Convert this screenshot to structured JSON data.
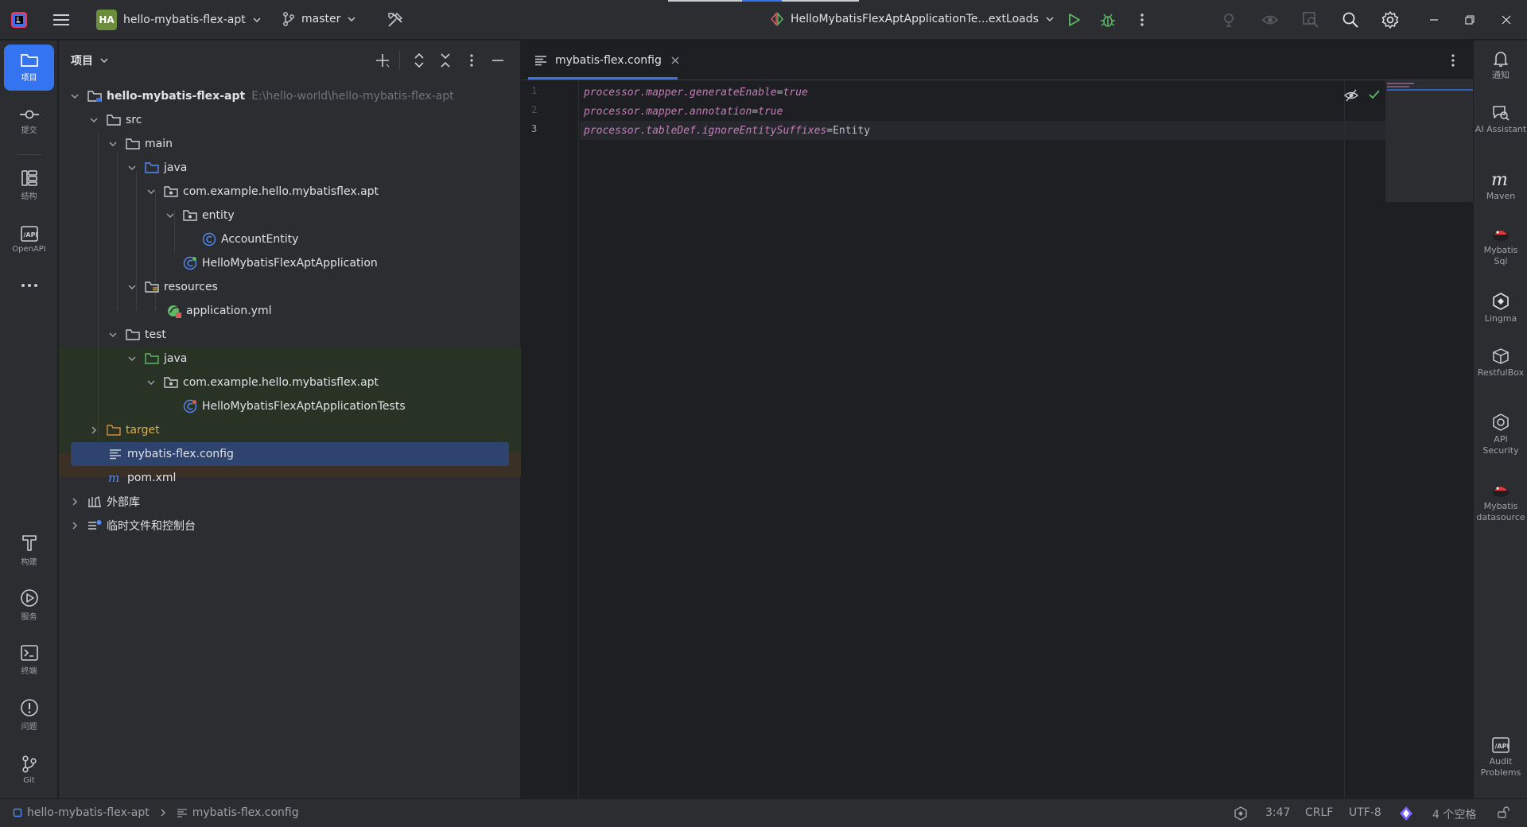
{
  "titlebar": {
    "project_badge": "HA",
    "project_name": "hello-mybatis-flex-apt",
    "branch": "master",
    "run_config": "HelloMybatisFlexAptApplicationTe...extLoads"
  },
  "left_strip": {
    "items": [
      {
        "label": "项目",
        "icon": "folder-icon"
      },
      {
        "label": "提交",
        "icon": "commit-icon"
      },
      {
        "label": "结构",
        "icon": "structure-icon"
      },
      {
        "label": "OpenAPI",
        "icon": "openapi-icon"
      },
      {
        "label": "构建",
        "icon": "hammer-icon"
      },
      {
        "label": "服务",
        "icon": "services-icon"
      },
      {
        "label": "终端",
        "icon": "terminal-icon"
      },
      {
        "label": "问题",
        "icon": "problems-icon"
      },
      {
        "label": "Git",
        "icon": "git-icon"
      }
    ]
  },
  "project_panel": {
    "title": "项目",
    "tree": [
      {
        "label": "hello-mybatis-flex-apt",
        "hint": "E:\\hello-world\\hello-mybatis-flex-apt"
      },
      {
        "label": "src"
      },
      {
        "label": "main"
      },
      {
        "label": "java"
      },
      {
        "label": "com.example.hello.mybatisflex.apt"
      },
      {
        "label": "entity"
      },
      {
        "label": "AccountEntity"
      },
      {
        "label": "HelloMybatisFlexAptApplication"
      },
      {
        "label": "resources"
      },
      {
        "label": "application.yml"
      },
      {
        "label": "test"
      },
      {
        "label": "java"
      },
      {
        "label": "com.example.hello.mybatisflex.apt"
      },
      {
        "label": "HelloMybatisFlexAptApplicationTests"
      },
      {
        "label": "target"
      },
      {
        "label": "mybatis-flex.config"
      },
      {
        "label": "pom.xml"
      },
      {
        "label": "外部库"
      },
      {
        "label": "临时文件和控制台"
      }
    ]
  },
  "editor": {
    "tab_label": "mybatis-flex.config",
    "lines": [
      {
        "num": "1",
        "key": "processor.mapper.generateEnable",
        "value": "true"
      },
      {
        "num": "2",
        "key": "processor.mapper.annotation",
        "value": "true"
      },
      {
        "num": "3",
        "key": "processor.tableDef.ignoreEntitySuffixes",
        "value": "Entity"
      }
    ]
  },
  "right_strip": {
    "items": [
      {
        "label": "通知",
        "icon": "bell-icon"
      },
      {
        "label": "AI Assistant",
        "icon": "ai-assistant-icon"
      },
      {
        "label": "Maven",
        "icon": "maven-icon"
      },
      {
        "label": "Mybatis Sql",
        "icon": "mybatis-sql-icon"
      },
      {
        "label": "Lingma",
        "icon": "lingma-icon"
      },
      {
        "label": "RestfulBox",
        "icon": "restful-box-icon"
      },
      {
        "label": "API Security",
        "icon": "api-security-icon"
      },
      {
        "label": "Mybatis datasource",
        "icon": "mybatis-datasource-icon"
      },
      {
        "label": "Audit Problems",
        "icon": "audit-problems-icon"
      }
    ]
  },
  "status_bar": {
    "breadcrumb_project": "hello-mybatis-flex-apt",
    "breadcrumb_file": "mybatis-flex.config",
    "position": "3:47",
    "line_separator": "CRLF",
    "encoding": "UTF-8",
    "indent": "4 个空格"
  },
  "colors": {
    "accent": "#3574f0",
    "selection": "#2e436e",
    "key_color": "#c77dbb",
    "test_root_bg": "#283326",
    "excluded_bg": "#3b3026"
  }
}
